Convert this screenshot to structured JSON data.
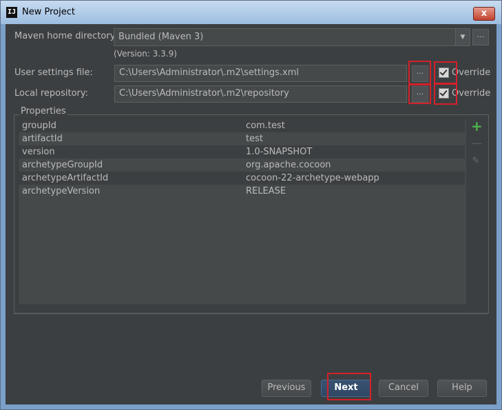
{
  "window": {
    "title": "New Project",
    "close_glyph": "x"
  },
  "maven_home": {
    "label": "Maven home directory:",
    "value": "Bundled (Maven 3)",
    "version": "(Version: 3.3.9)"
  },
  "user_settings": {
    "label": "User settings file:",
    "value": "C:\\Users\\Administrator\\.m2\\settings.xml",
    "override_label": "Override",
    "override_checked": true
  },
  "local_repository": {
    "label": "Local repository:",
    "value": "C:\\Users\\Administrator\\.m2\\repository",
    "override_label": "Override",
    "override_checked": true
  },
  "browse_label": "...",
  "properties": {
    "title": "Properties",
    "rows": [
      {
        "key": "groupId",
        "value": "com.test"
      },
      {
        "key": "artifactId",
        "value": "test"
      },
      {
        "key": "version",
        "value": "1.0-SNAPSHOT"
      },
      {
        "key": "archetypeGroupId",
        "value": "org.apache.cocoon"
      },
      {
        "key": "archetypeArtifactId",
        "value": "cocoon-22-archetype-webapp"
      },
      {
        "key": "archetypeVersion",
        "value": "RELEASE"
      }
    ],
    "icons": {
      "add": "plus-icon",
      "remove": "minus-icon",
      "edit": "pencil-icon"
    }
  },
  "buttons": {
    "previous": "Previous",
    "next": "Next",
    "cancel": "Cancel",
    "help": "Help"
  },
  "colors": {
    "highlight": "#d6202a",
    "add_icon": "#4bb34b",
    "dialog_bg": "#3c3f41"
  }
}
